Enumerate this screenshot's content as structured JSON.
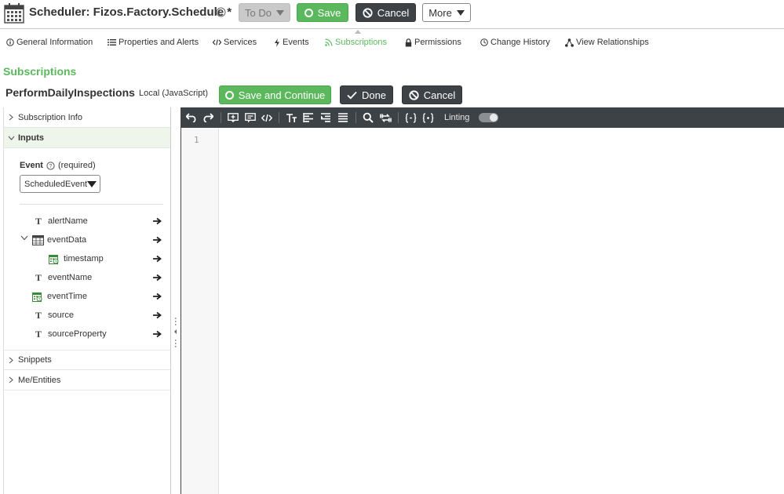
{
  "header": {
    "title": "Scheduler: Fizos.Factory.Schedule *",
    "buttons": {
      "todo": "To Do",
      "save": "Save",
      "cancel": "Cancel",
      "more": "More"
    }
  },
  "tabs": [
    {
      "label": "General Information",
      "icon": "info-icon"
    },
    {
      "label": "Properties and Alerts",
      "icon": "list-icon"
    },
    {
      "label": "Services",
      "icon": "code-icon"
    },
    {
      "label": "Events",
      "icon": "lightning-icon"
    },
    {
      "label": "Subscriptions",
      "icon": "rss-icon",
      "active": true
    },
    {
      "label": "Permissions",
      "icon": "lock-icon"
    },
    {
      "label": "Change History",
      "icon": "clock-icon"
    },
    {
      "label": "View Relationships",
      "icon": "network-icon"
    }
  ],
  "section": {
    "title": "Subscriptions",
    "subscription_name": "PerformDailyInspections",
    "language": "Local (JavaScript)",
    "buttons": {
      "save_continue": "Save and Continue",
      "done": "Done",
      "cancel": "Cancel"
    }
  },
  "left_panel": {
    "subscription_info": "Subscription Info",
    "inputs": "Inputs",
    "event_label": "Event",
    "event_required": "(required)",
    "event_selected": "ScheduledEvent",
    "fields": [
      {
        "name": "alertName",
        "type": "text"
      },
      {
        "name": "eventData",
        "type": "infotable"
      },
      {
        "name": "timestamp",
        "type": "datetime"
      },
      {
        "name": "eventName",
        "type": "text"
      },
      {
        "name": "eventTime",
        "type": "datetime"
      },
      {
        "name": "source",
        "type": "text"
      },
      {
        "name": "sourceProperty",
        "type": "text"
      }
    ],
    "snippets": "Snippets",
    "me_entities": "Me/Entities"
  },
  "editor": {
    "linting_label": "Linting",
    "linting_enabled": true,
    "line_numbers": [
      "1"
    ]
  },
  "colors": {
    "accent_green": "#5bb85d",
    "dark_button": "#3d4247",
    "toolbar": "#3d4247"
  }
}
